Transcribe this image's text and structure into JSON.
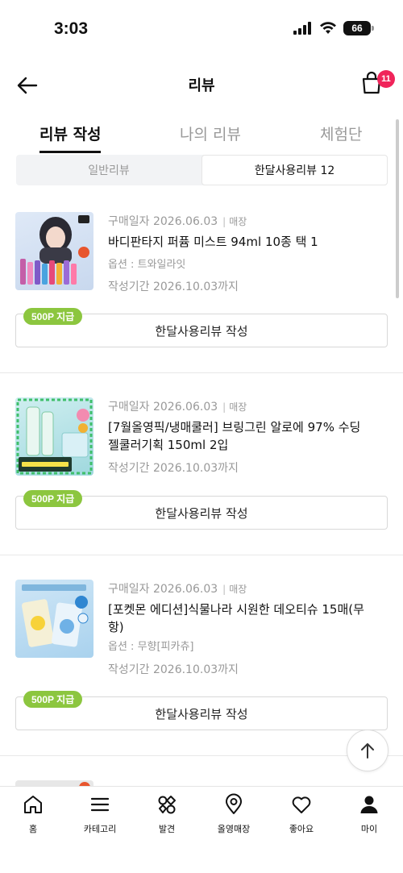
{
  "status_bar": {
    "time": "3:03",
    "battery": "66"
  },
  "header": {
    "title": "리뷰",
    "cart_count": "11"
  },
  "tabs": [
    {
      "label": "리뷰 작성",
      "active": true
    },
    {
      "label": "나의 리뷰",
      "active": false
    },
    {
      "label": "체험단",
      "active": false
    }
  ],
  "segment": {
    "general": "일반리뷰",
    "monthly": "한달사용리뷰 12"
  },
  "reviews": [
    {
      "purchase_date": "구매일자 2026.06.03",
      "store": "매장",
      "name": "바디판타지 퍼퓸 미스트 94ml 10종 택 1",
      "option": "옵션 : 트와일라잇",
      "deadline": "작성기간 2026.10.03까지",
      "point_badge": "500P 지급",
      "button": "한달사용리뷰 작성"
    },
    {
      "purchase_date": "구매일자 2026.06.03",
      "store": "매장",
      "name": "[7월올영픽/냉매쿨러] 브링그린 알로에 97% 수딩 젤쿨러기획 150ml 2입",
      "option": "",
      "deadline": "작성기간 2026.10.03까지",
      "point_badge": "500P 지급",
      "button": "한달사용리뷰 작성"
    },
    {
      "purchase_date": "구매일자 2026.06.03",
      "store": "매장",
      "name": "[포켓몬 에디션]식물나라 시원한 데오티슈 15매(무항)",
      "option": "옵션 : 무향[피카츄]",
      "deadline": "작성기간 2026.10.03까지",
      "point_badge": "500P 지급",
      "button": "한달사용리뷰 작성"
    }
  ],
  "bottom_nav": [
    {
      "label": "홈",
      "icon": "home-icon"
    },
    {
      "label": "카테고리",
      "icon": "menu-icon"
    },
    {
      "label": "발견",
      "icon": "discover-icon"
    },
    {
      "label": "올영매장",
      "icon": "location-pin-icon"
    },
    {
      "label": "좋아요",
      "icon": "heart-icon"
    },
    {
      "label": "마이",
      "icon": "person-icon"
    }
  ],
  "colors": {
    "point_badge": "#8cc63f",
    "cart_badge": "#f0245a"
  }
}
